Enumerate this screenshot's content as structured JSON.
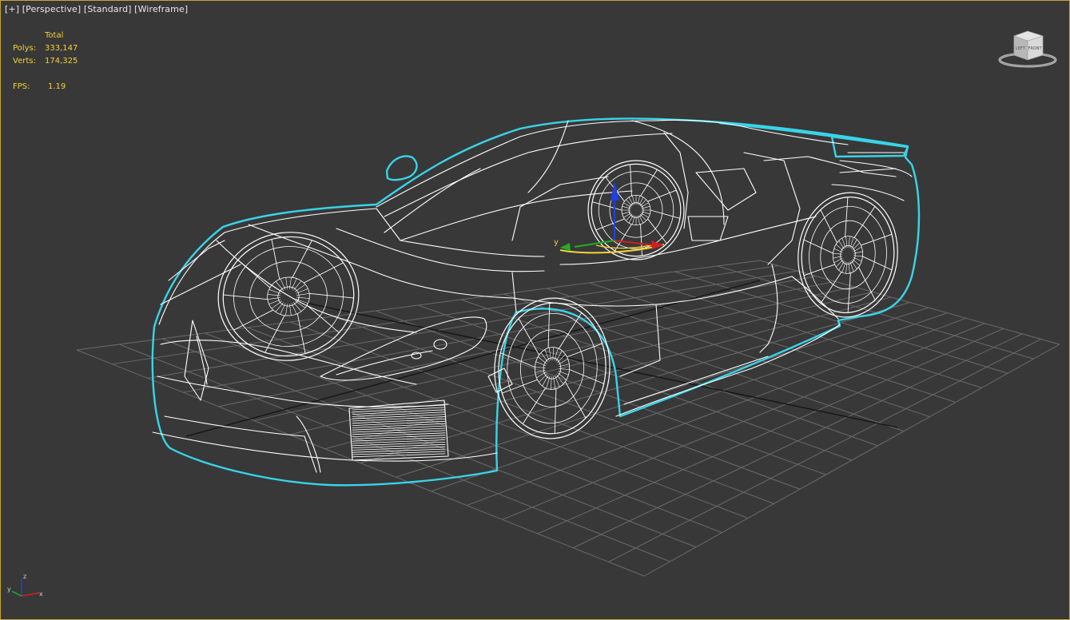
{
  "viewport": {
    "label_plus": "[+]",
    "label_view": "[Perspective]",
    "label_shading": "[Standard]",
    "label_mode": "[Wireframe]"
  },
  "stats": {
    "header": "Total",
    "polys_label": "Polys:",
    "polys_value": "333,147",
    "verts_label": "Verts:",
    "verts_value": "174,325",
    "fps_label": "FPS:",
    "fps_value": "1.19"
  },
  "viewcube": {
    "left_face": "LEFT",
    "front_face": "FRONT"
  },
  "gizmo": {
    "x_label": "x",
    "y_label": "y",
    "z_label": "z"
  },
  "colors": {
    "viewport_bg": "#383838",
    "active_border": "#c8a530",
    "stats_text": "#f2d23a",
    "grid": "#6a6a6a",
    "wire": "#ffffff",
    "selection_outline": "#38d4e8",
    "axis_x": "#d02020",
    "axis_y": "#20b020",
    "axis_z": "#2040e0"
  },
  "icons": {
    "viewcube": "viewcube-icon",
    "transform_gizmo": "transform-gizmo-icon",
    "axis_tripod": "axis-tripod-icon"
  }
}
